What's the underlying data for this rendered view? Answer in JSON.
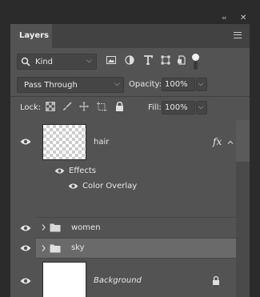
{
  "window": {
    "collapse_glyph": "‹‹",
    "close_glyph": "✕"
  },
  "panel": {
    "tab_label": "Layers"
  },
  "filter": {
    "label": "Kind",
    "chevron": "⌵"
  },
  "blend": {
    "mode": "Pass Through",
    "opacity_label": "Opacity:",
    "opacity_value": "100%"
  },
  "lock": {
    "label": "Lock:",
    "fill_label": "Fill:",
    "fill_value": "100%"
  },
  "layers": [
    {
      "name": "hair",
      "type": "layer",
      "visible": true,
      "fx": "fx",
      "expanded": true,
      "selected": false
    },
    {
      "name": "Effects",
      "type": "effects-group",
      "visible": true
    },
    {
      "name": "Color Overlay",
      "type": "effect",
      "visible": true
    },
    {
      "name": "women",
      "type": "group",
      "visible": true,
      "selected": false
    },
    {
      "name": "sky",
      "type": "group",
      "visible": true,
      "selected": true
    },
    {
      "name": "Background",
      "type": "background",
      "visible": true,
      "locked": true
    }
  ],
  "colors": {
    "panel_bg": "#535353",
    "dark_bg": "#2b2b2b",
    "selected_row": "#6a6a6a",
    "text": "#e8e8e8"
  }
}
